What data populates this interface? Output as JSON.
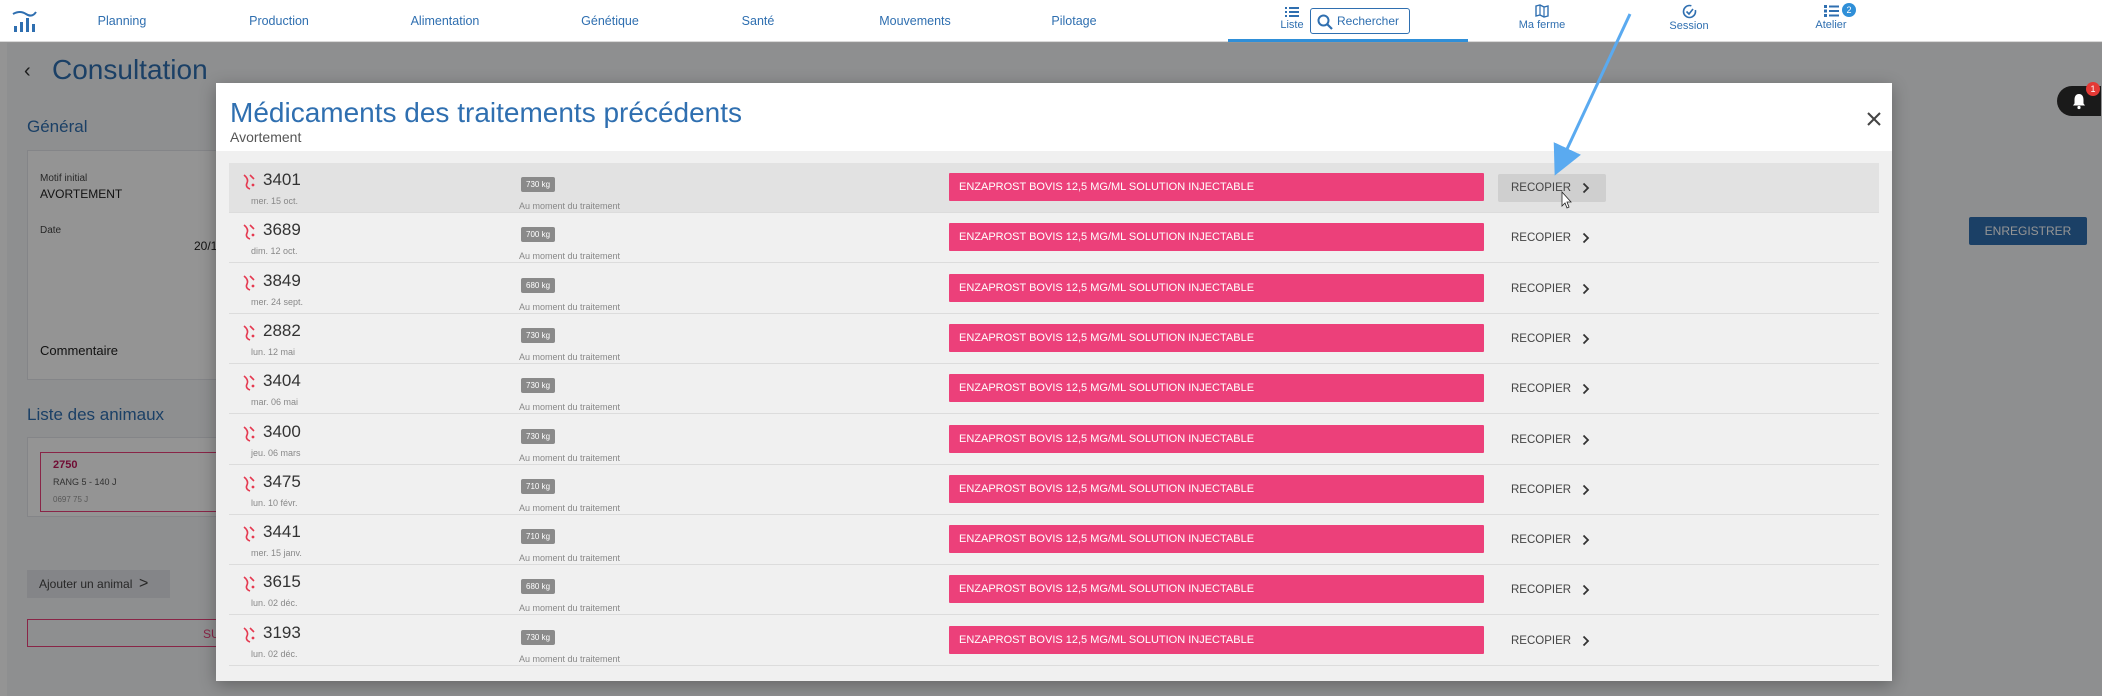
{
  "nav": {
    "items": [
      {
        "label": "Planning"
      },
      {
        "label": "Production"
      },
      {
        "label": "Alimentation"
      },
      {
        "label": "Génétique"
      },
      {
        "label": "Santé"
      },
      {
        "label": "Mouvements"
      },
      {
        "label": "Pilotage"
      }
    ],
    "liste_label": "Liste",
    "search_placeholder": "Rechercher",
    "ma_ferme_label": "Ma ferme",
    "session_label": "Session",
    "atelier_label": "Atelier",
    "atelier_badge": "2"
  },
  "page": {
    "title": "Consultation",
    "general_title": "Général",
    "motif_label": "Motif initial",
    "motif_value": "AVORTEMENT",
    "date_label": "Date",
    "date_value": "20/1",
    "commentaire_label": "Commentaire",
    "liste_animaux_title": "Liste des animaux",
    "animal_number": "2750",
    "animal_rang": "RANG 5 - 140 J",
    "animal_extra": "0697 75 J",
    "add_animal_label": "Ajouter un animal",
    "red_button_partial": "SU",
    "save_label": "ENREGISTRER"
  },
  "notifications": {
    "count": "1"
  },
  "modal": {
    "title": "Médicaments des traitements précédents",
    "subtitle": "Avortement",
    "rows": [
      {
        "number": "3401",
        "date": "mer. 15 oct.",
        "weight": "730 kg",
        "weight_note": "Au moment du traitement",
        "drug": "ENZAPROST BOVIS 12,5 MG/ML SOLUTION INJECTABLE",
        "action": "RECOPIER"
      },
      {
        "number": "3689",
        "date": "dim. 12 oct.",
        "weight": "700 kg",
        "weight_note": "Au moment du traitement",
        "drug": "ENZAPROST BOVIS 12,5 MG/ML SOLUTION INJECTABLE",
        "action": "RECOPIER"
      },
      {
        "number": "3849",
        "date": "mer. 24 sept.",
        "weight": "680 kg",
        "weight_note": "Au moment du traitement",
        "drug": "ENZAPROST BOVIS 12,5 MG/ML SOLUTION INJECTABLE",
        "action": "RECOPIER"
      },
      {
        "number": "2882",
        "date": "lun. 12 mai",
        "weight": "730 kg",
        "weight_note": "Au moment du traitement",
        "drug": "ENZAPROST BOVIS 12,5 MG/ML SOLUTION INJECTABLE",
        "action": "RECOPIER"
      },
      {
        "number": "3404",
        "date": "mar. 06 mai",
        "weight": "730 kg",
        "weight_note": "Au moment du traitement",
        "drug": "ENZAPROST BOVIS 12,5 MG/ML SOLUTION INJECTABLE",
        "action": "RECOPIER"
      },
      {
        "number": "3400",
        "date": "jeu. 06 mars",
        "weight": "730 kg",
        "weight_note": "Au moment du traitement",
        "drug": "ENZAPROST BOVIS 12,5 MG/ML SOLUTION INJECTABLE",
        "action": "RECOPIER"
      },
      {
        "number": "3475",
        "date": "lun. 10 févr.",
        "weight": "710 kg",
        "weight_note": "Au moment du traitement",
        "drug": "ENZAPROST BOVIS 12,5 MG/ML SOLUTION INJECTABLE",
        "action": "RECOPIER"
      },
      {
        "number": "3441",
        "date": "mer. 15 janv.",
        "weight": "710 kg",
        "weight_note": "Au moment du traitement",
        "drug": "ENZAPROST BOVIS 12,5 MG/ML SOLUTION INJECTABLE",
        "action": "RECOPIER"
      },
      {
        "number": "3615",
        "date": "lun. 02 déc.",
        "weight": "680 kg",
        "weight_note": "Au moment du traitement",
        "drug": "ENZAPROST BOVIS 12,5 MG/ML SOLUTION INJECTABLE",
        "action": "RECOPIER"
      },
      {
        "number": "3193",
        "date": "lun. 02 déc.",
        "weight": "730 kg",
        "weight_note": "Au moment du traitement",
        "drug": "ENZAPROST BOVIS 12,5 MG/ML SOLUTION INJECTABLE",
        "action": "RECOPIER"
      }
    ]
  },
  "colors": {
    "brand_blue": "#2f6fb0",
    "drug_pink": "#ec407a",
    "annotation_arrow": "#5aaaf0"
  },
  "icons": {
    "logo": "herd-chart-logo",
    "cow": "cow-alert-icon",
    "close": "close-icon",
    "bell": "bell-icon",
    "search": "search-icon"
  }
}
